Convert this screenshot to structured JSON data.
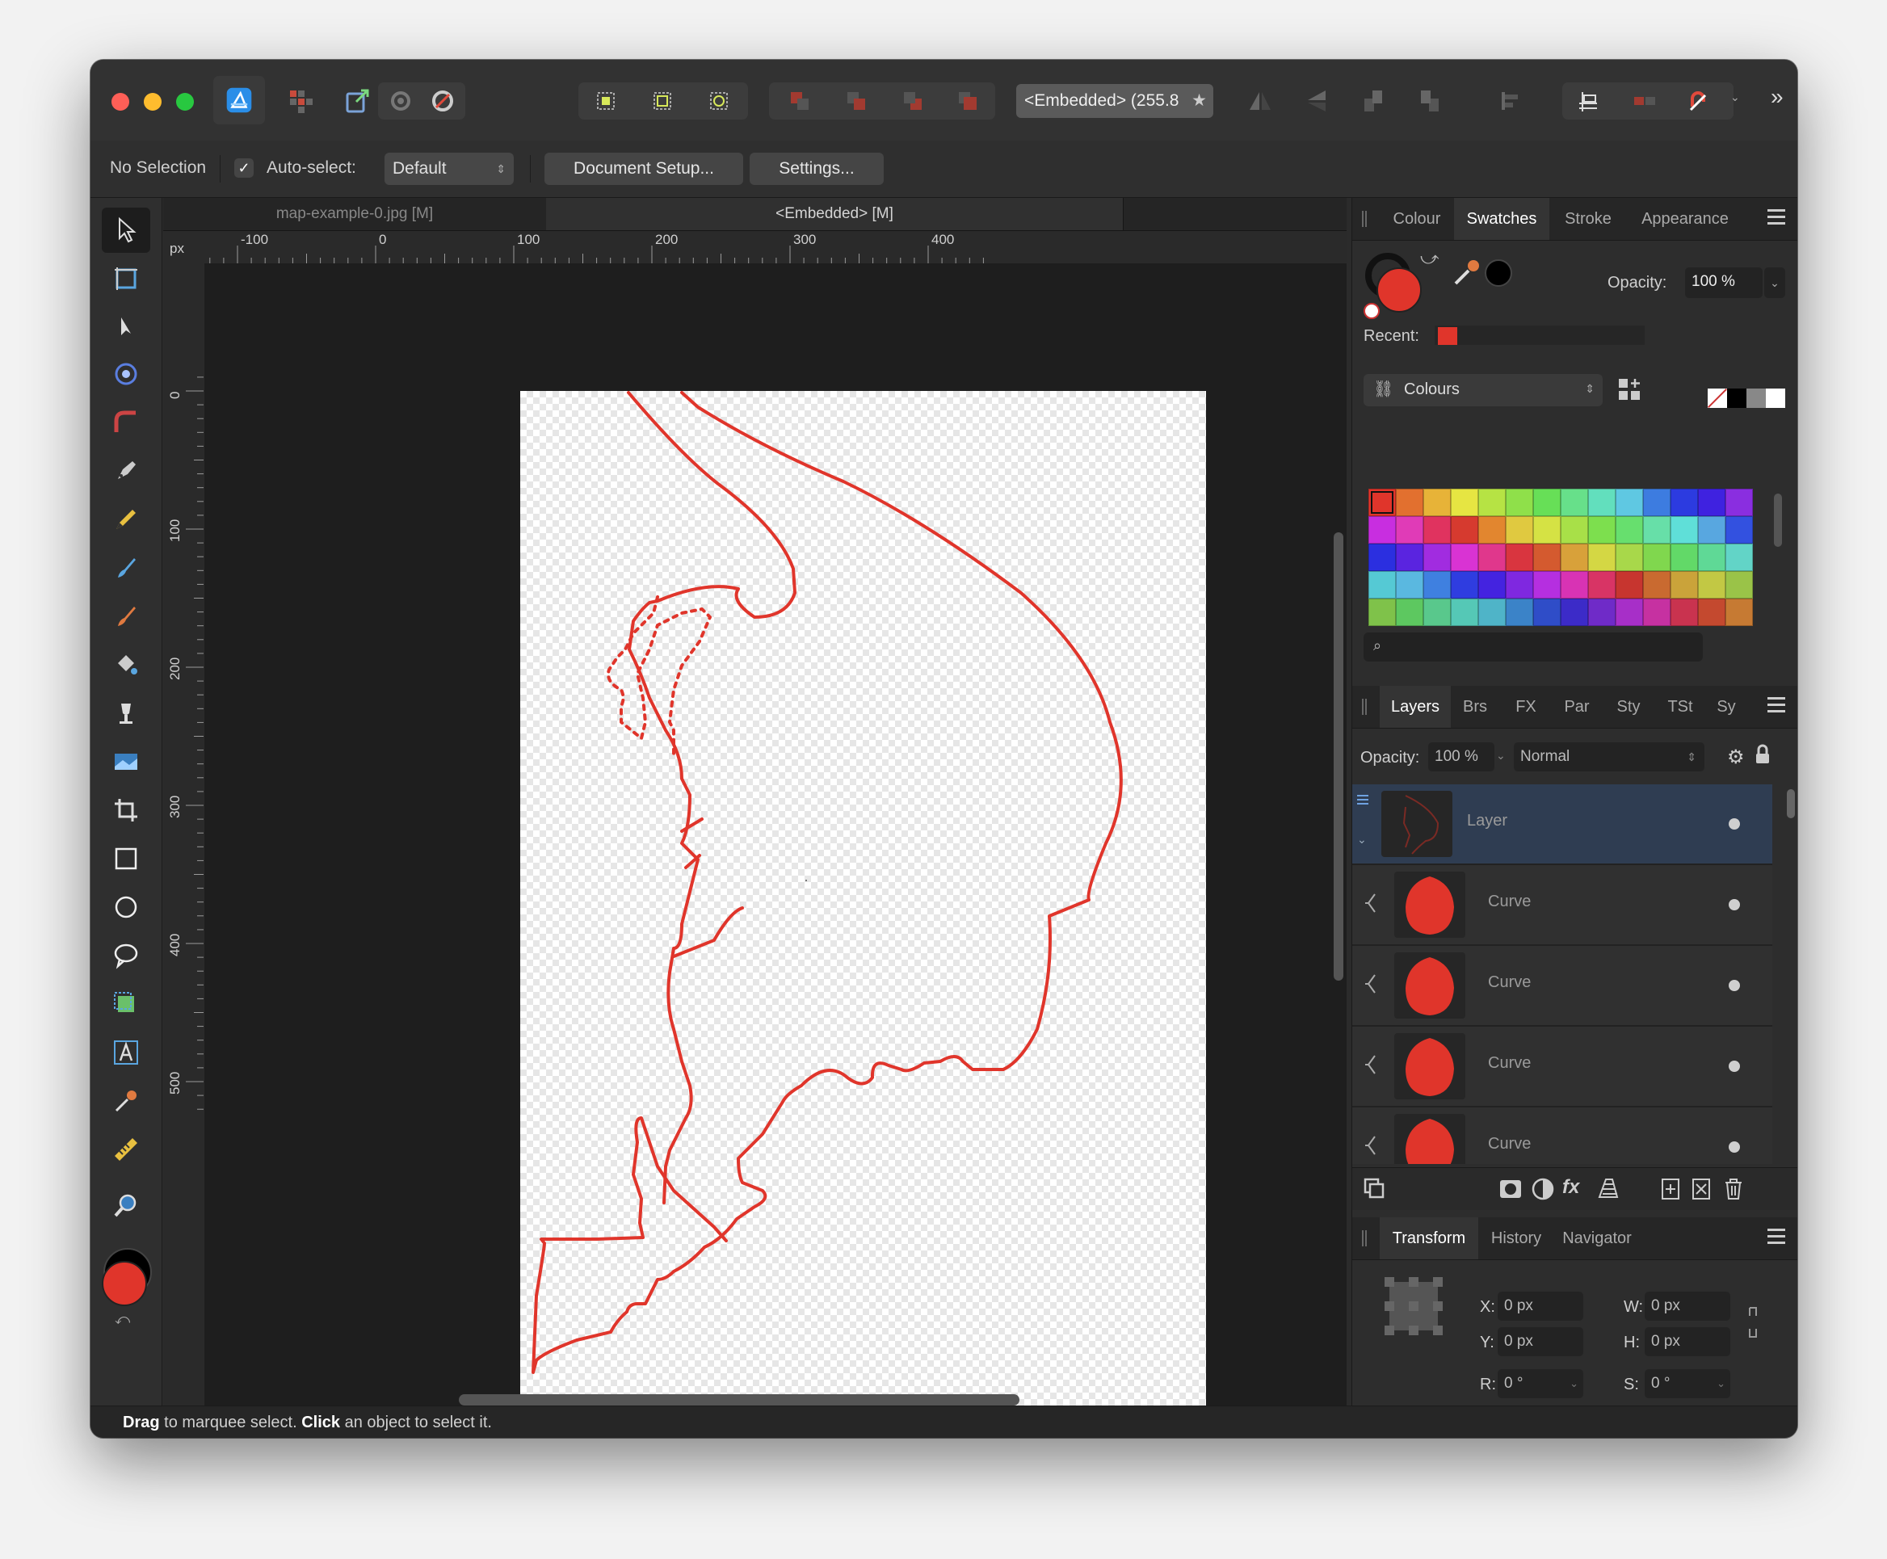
{
  "toolbar": {
    "doc_field": "<Embedded> (255.8 "
  },
  "context": {
    "selection": "No Selection",
    "auto_select_label": "Auto-select:",
    "auto_select_value": "Default",
    "document_setup": "Document Setup...",
    "settings": "Settings..."
  },
  "tabs": [
    "map-example-0.jpg [M]",
    "<Embedded> [M]"
  ],
  "ruler": {
    "unit": "px",
    "h_labels": [
      "-100",
      "0",
      "100",
      "200",
      "300",
      "400"
    ],
    "v_labels": [
      "0",
      "100",
      "200",
      "300",
      "400",
      "500"
    ]
  },
  "status": {
    "drag": "Drag",
    "drag_text": "to marquee select.",
    "click": "Click",
    "click_text": "an object to select it."
  },
  "colour_panel": {
    "tabs": [
      "Colour",
      "Swatches",
      "Stroke",
      "Appearance"
    ],
    "active_tab": "Swatches",
    "opacity_label": "Opacity:",
    "opacity_value": "100 %",
    "recent_label": "Recent:",
    "palette": "Colours",
    "fill_color": "#e0352b",
    "swatches": [
      "#e0352b",
      "#e2702f",
      "#e7b338",
      "#e6e542",
      "#b6e344",
      "#8fe04a",
      "#67df57",
      "#67e08a",
      "#62dfbd",
      "#5fc8e2",
      "#3d7ce0",
      "#2c3be0",
      "#3f22e0",
      "#8a2ee0",
      "#c82ee0",
      "#e03bb7",
      "#e0335f",
      "#d63a2f",
      "#e2862f",
      "#e0c940",
      "#d5e244",
      "#a8e048",
      "#7ddf4e",
      "#67df6e",
      "#67dfa8",
      "#5fdfd8",
      "#58a7e0",
      "#3351e0",
      "#2b2fe0",
      "#5a24e0",
      "#a12ce0",
      "#d933d3",
      "#e0378c",
      "#d9353f",
      "#d45a2f",
      "#d8a13a",
      "#d4d744",
      "#a8d84a",
      "#80d74e",
      "#62d968",
      "#5fd996",
      "#62d4c7",
      "#55c9d4",
      "#5ab8e0",
      "#3f80e0",
      "#2f3de0",
      "#4423e0",
      "#7f28e0",
      "#b52fe0",
      "#d833b4",
      "#d83465",
      "#c7352f",
      "#c96a30",
      "#caa33a",
      "#c2c844",
      "#9ac348",
      "#7fc24a",
      "#5dc860",
      "#59c88c",
      "#55c8b6",
      "#4fb4c8",
      "#3b83c8",
      "#2f4dc8",
      "#3c2bc8",
      "#6f2bc8",
      "#a72fc8",
      "#c631a1",
      "#c9334f",
      "#c4492f",
      "#c67a33"
    ]
  },
  "layers_panel": {
    "tabs": [
      "Layers",
      "Brs",
      "FX",
      "Par",
      "Sty",
      "TSt",
      "Sy"
    ],
    "active_tab": "Layers",
    "opacity_label": "Opacity:",
    "opacity_value": "100 %",
    "blend_mode": "Normal",
    "items": [
      {
        "name": "Layer",
        "selected": true
      },
      {
        "name": "Curve",
        "selected": false
      },
      {
        "name": "Curve",
        "selected": false
      },
      {
        "name": "Curve",
        "selected": false
      },
      {
        "name": "Curve",
        "selected": false
      }
    ]
  },
  "transform_panel": {
    "tabs": [
      "Transform",
      "History",
      "Navigator"
    ],
    "active_tab": "Transform",
    "x_label": "X:",
    "x_value": "0 px",
    "y_label": "Y:",
    "y_value": "0 px",
    "w_label": "W:",
    "w_value": "0 px",
    "h_label": "H:",
    "h_value": "0 px",
    "r_label": "R:",
    "r_value": "0 °",
    "s_label": "S:",
    "s_value": "0 °"
  },
  "drawing": {
    "stroke_color": "#e0352b"
  }
}
